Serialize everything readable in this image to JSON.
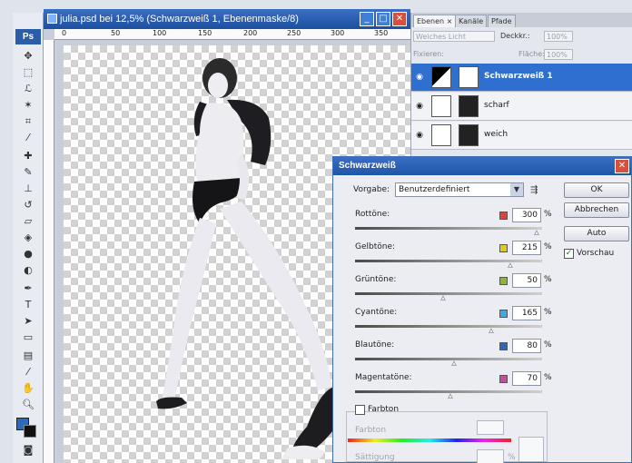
{
  "document": {
    "title": "julia.psd bei 12,5% (Schwarzweiß 1, Ebenenmaske/8)",
    "ruler_labels": [
      "0",
      "50",
      "100",
      "150",
      "200",
      "250",
      "300",
      "350"
    ]
  },
  "toolbox": {
    "logo": "Ps",
    "tools": [
      "move-tool",
      "marquee-tool",
      "lasso-tool",
      "magic-wand-tool",
      "crop-tool",
      "slice-tool",
      "healing-tool",
      "brush-tool",
      "stamp-tool",
      "history-brush-tool",
      "eraser-tool",
      "bucket-tool",
      "blur-tool",
      "dodge-tool",
      "pen-tool",
      "type-tool",
      "path-select-tool",
      "shape-tool",
      "notes-tool",
      "eyedropper-tool",
      "hand-tool",
      "zoom-tool"
    ],
    "foreground_color": "#2a6bbd",
    "background_color": "#111111"
  },
  "layers_panel": {
    "tabs": [
      "Ebenen ×",
      "Kanäle",
      "Pfade"
    ],
    "blend_mode": "Weiches Licht",
    "opacity_label": "Deckkr.:",
    "opacity_value": "100%",
    "lock_label": "Fixieren:",
    "fill_label": "Fläche:",
    "fill_value": "100%",
    "layers": [
      {
        "name": "Schwarzweiß 1",
        "selected": true
      },
      {
        "name": "scharf",
        "selected": false
      },
      {
        "name": "weich",
        "selected": false
      }
    ]
  },
  "dialog": {
    "title": "Schwarzweiß",
    "preset_label": "Vorgabe:",
    "preset_value": "Benutzerdefiniert",
    "buttons": {
      "ok": "OK",
      "cancel": "Abbrechen",
      "auto": "Auto"
    },
    "preview_label": "Vorschau",
    "preview_checked": true,
    "sliders": [
      {
        "label": "Rottöne:",
        "value": "300",
        "color": "#d9473a",
        "fraction": 0.97
      },
      {
        "label": "Gelbtöne:",
        "value": "215",
        "color": "#e0c92e",
        "fraction": 0.83
      },
      {
        "label": "Grüntöne:",
        "value": "50",
        "color": "#8fb240",
        "fraction": 0.47
      },
      {
        "label": "Cyantöne:",
        "value": "165",
        "color": "#4aa6d8",
        "fraction": 0.73
      },
      {
        "label": "Blautöne:",
        "value": "80",
        "color": "#2d66b8",
        "fraction": 0.53
      },
      {
        "label": "Magentatöne:",
        "value": "70",
        "color": "#c4509a",
        "fraction": 0.51
      }
    ],
    "percent_sign": "%",
    "tint_label": "Farbton",
    "tint_checked": false,
    "hue_label": "Farbton",
    "saturation_label": "Sättigung"
  }
}
